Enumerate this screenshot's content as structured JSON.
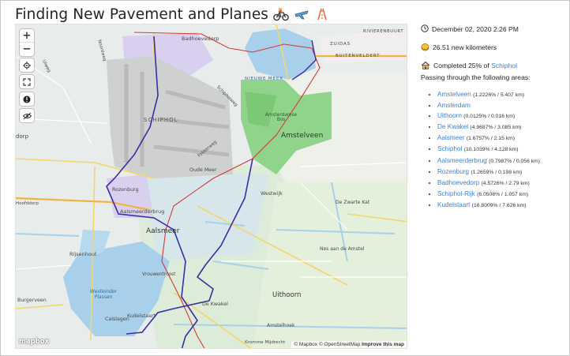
{
  "page": {
    "title": "Finding New Pavement and Planes"
  },
  "icons": {
    "title": [
      "bicycle-riders-icon",
      "airplane-icon",
      "road-icon"
    ],
    "date": "clock-icon",
    "distance": "gold-coin-icon",
    "completion": "house-icon"
  },
  "map": {
    "controls": {
      "zoom_in": "+",
      "zoom_out": "−"
    },
    "labels": {
      "badhoevedorp": "Badhoevedorp",
      "zuidas": "ZUIDAS",
      "rivierenbuurt": "RIVIERENBUURT",
      "buitenveldert": "BUITENVELDERT",
      "nieuwe_meer": "NIEUWE MEER",
      "schiphol": "SCHIPHOL",
      "amsterdamse_bos": "Amsterdamse Bos",
      "amstelveen": "Amstelveen",
      "rozenburg": "Rozenburg",
      "aalsmeerderbrug": "Aalsmeerderbrug",
      "aalsmeer": "Aalsmeer",
      "rijsenhout": "Rijsenhout",
      "westeinder": "Westeinder Plassen",
      "uithoorn": "Uithoorn",
      "de_kwakel": "De Kwakel",
      "kudelstaart": "Kudelstaart",
      "burgerveen": "Burgerveen",
      "calslagen": "Calslagen",
      "oude_meer": "Oude Meer",
      "westwijk": "Westwijk",
      "de_zwarte_kat": "De Zwarte Kat",
      "nes_aan_de_amstel": "Nes aan de Amstel",
      "vrouwentroost": "Vrouwentroost",
      "amstelhoek": "Amstelhoek",
      "kromme_mijdrecht": "Kromme Mijdrecht",
      "dorp": "dorp",
      "uiweg": "Uiweg",
      "hoofddorp_road": "Hoofddorp",
      "schipholweg": "Schipholweg",
      "fokkerweg": "Fokkerweg",
      "noordweg": "Noordweg"
    },
    "attribution": {
      "mapbox": "© Mapbox",
      "osm": "© OpenStreetMap",
      "improve": "Improve this map"
    },
    "logo": "mapbox"
  },
  "summary": {
    "date": "December 02, 2020 2:26 PM",
    "distance": "26.51 new kilometers",
    "completed_prefix": "Completed 25% of",
    "completed_place": "Schiphol",
    "passing_label": "Passing through the following areas:"
  },
  "areas": [
    {
      "name": "Amstelveen",
      "meta": "(1.2226% / 5.407 km)"
    },
    {
      "name": "Amsterdam",
      "meta": ""
    },
    {
      "name": "Uithoorn",
      "meta": "(0.0125% / 0.016 km)"
    },
    {
      "name": "De Kwakel",
      "meta": "(4.9687% / 3.085 km)"
    },
    {
      "name": "Aalsmeer",
      "meta": "(1.6757% / 2.15 km)"
    },
    {
      "name": "Schiphol",
      "meta": "(10.1039% / 4.128 km)"
    },
    {
      "name": "Aalsmeerderbrug",
      "meta": "(0.7987% / 0.056 km)"
    },
    {
      "name": "Rozenburg",
      "meta": "(1.2659% / 0.198 km)"
    },
    {
      "name": "Badhoevedorp",
      "meta": "(4.5726% / 2.79 km)"
    },
    {
      "name": "Schiphol-Rijk",
      "meta": "(6.0506% / 1.057 km)"
    },
    {
      "name": "Kudelstaart",
      "meta": "(16.8009% / 7.626 km)"
    }
  ],
  "colors": {
    "link": "#3b82d6",
    "route": "#3a2ca8",
    "boundary": "#d23b3b",
    "water": "#a9d0ea",
    "park": "#8fd48a"
  }
}
